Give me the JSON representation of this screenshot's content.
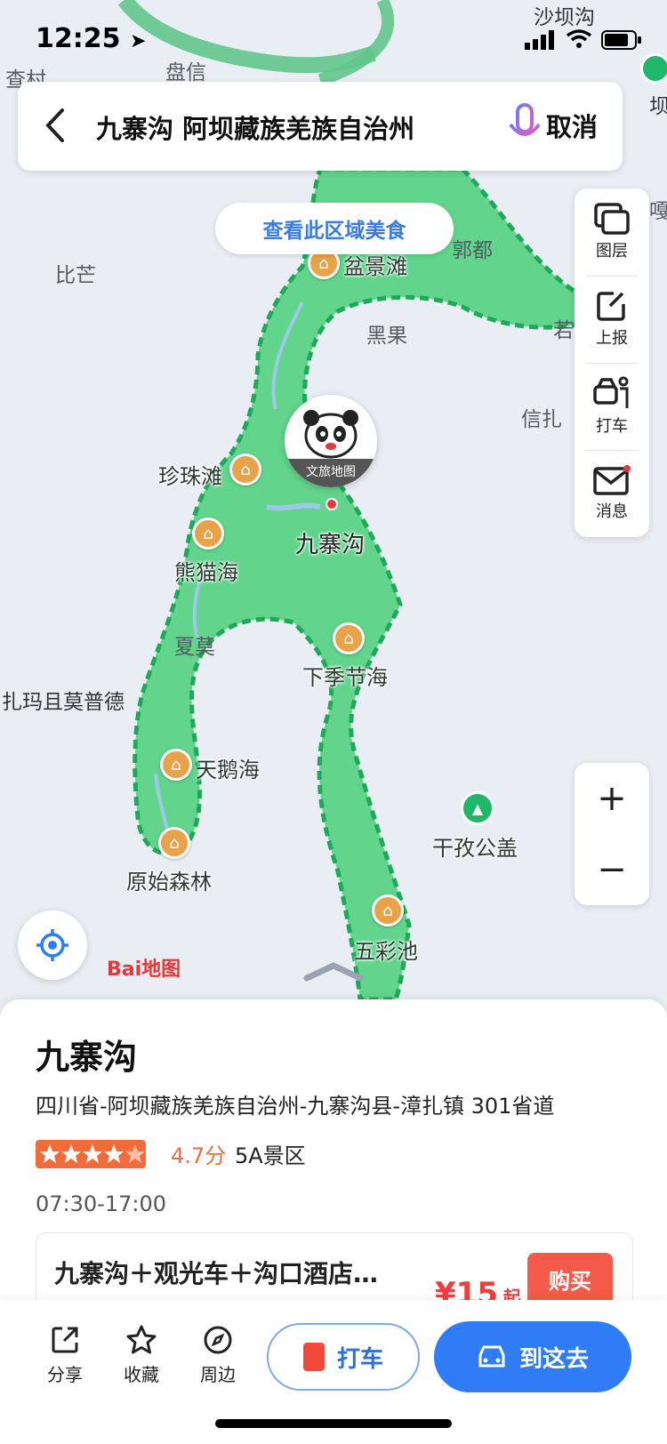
{
  "status_bar": {
    "time": "12:25",
    "location_arrow": "location-arrow-icon"
  },
  "map": {
    "top_labels": [
      "盘信",
      "沙坝沟",
      "查村",
      "坝"
    ],
    "region_labels": [
      "比芒",
      "郭都",
      "黑果",
      "信扎",
      "若",
      "扎玛且莫普德",
      "夏莫",
      "嘎"
    ],
    "pois": [
      {
        "name": "盆景滩"
      },
      {
        "name": "珍珠滩"
      },
      {
        "name": "熊猫海"
      },
      {
        "name": "下季节海"
      },
      {
        "name": "天鹅海"
      },
      {
        "name": "原始森林"
      },
      {
        "name": "五彩池"
      }
    ],
    "mountain_poi": "干孜公盖",
    "center_label": "九寨沟",
    "mascot_caption": "文旅地图",
    "brand": "Bai地图",
    "colors": {
      "scenic_fill": "#62d48c",
      "scenic_border": "#1fa85a",
      "poi": "#e8a24a"
    }
  },
  "search": {
    "query": "九寨沟 阿坝藏族羌族自治州",
    "cancel_label": "取消"
  },
  "food_pill": "查看此区域美食",
  "tools": [
    {
      "label": "图层",
      "icon": "layers-icon"
    },
    {
      "label": "上报",
      "icon": "edit-report-icon"
    },
    {
      "label": "打车",
      "icon": "taxi-person-icon"
    },
    {
      "label": "消息",
      "icon": "mail-icon"
    }
  ],
  "zoom": {
    "in": "+",
    "out": "−"
  },
  "place": {
    "title": "九寨沟",
    "address": "四川省-阿坝藏族羌族自治州-九寨沟县-漳扎镇 301省道",
    "rating_value": 4.7,
    "rating_text": "4.7分",
    "rank": "5A景区",
    "hours": "07:30-17:00",
    "ticket": {
      "title": "九寨沟＋观光车＋沟口酒店…",
      "price": "¥15",
      "price_suffix": "起",
      "buy_label": "购买"
    }
  },
  "actions": [
    {
      "label": "分享",
      "icon": "share-icon"
    },
    {
      "label": "收藏",
      "icon": "star-icon"
    },
    {
      "label": "周边",
      "icon": "compass-icon"
    }
  ],
  "taxi_button": "打车",
  "go_button": "到这去",
  "accent": "#2f7cf6"
}
